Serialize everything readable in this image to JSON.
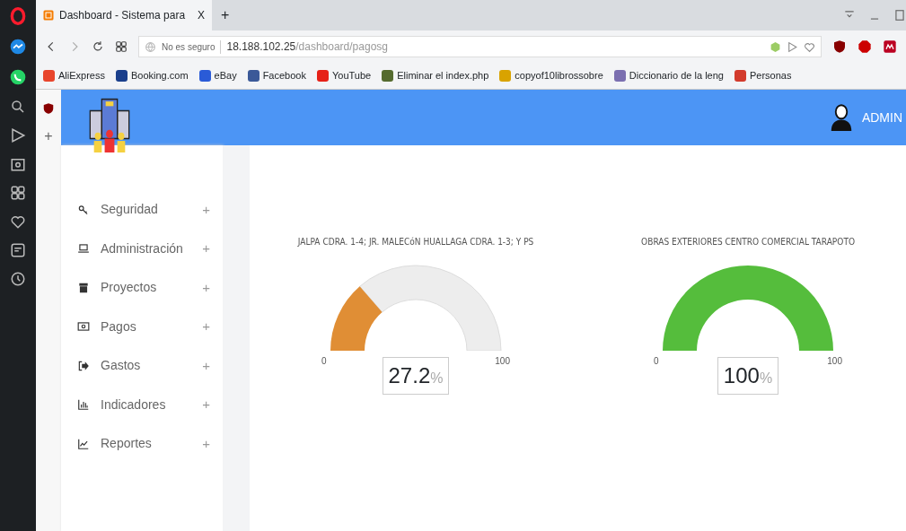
{
  "browser": {
    "tab_title": "Dashboard - Sistema para",
    "tab_close": "X",
    "new_tab": "+",
    "security": "No es seguro",
    "url_host": "18.188.102.25",
    "url_path": "/dashboard/pagosg"
  },
  "bookmarks": [
    {
      "label": "AliExpress",
      "color": "#e8452c"
    },
    {
      "label": "Booking.com",
      "color": "#1a3f8c"
    },
    {
      "label": "eBay",
      "color": "#2a5bd7"
    },
    {
      "label": "Facebook",
      "color": "#3b5998"
    },
    {
      "label": "YouTube",
      "color": "#e62117"
    },
    {
      "label": "Eliminar el index.php",
      "color": "#556b2f"
    },
    {
      "label": "copyof10librossobre",
      "color": "#d9a300"
    },
    {
      "label": "Diccionario de la leng",
      "color": "#7b6fb0"
    },
    {
      "label": "Personas",
      "color": "#d33b2c"
    }
  ],
  "side_panel": {
    "add": "+"
  },
  "header": {
    "user": "ADMIN"
  },
  "menu": [
    {
      "label": "Seguridad",
      "kind": "key",
      "expand": "+"
    },
    {
      "label": "Administración",
      "kind": "laptop",
      "expand": "+"
    },
    {
      "label": "Proyectos",
      "kind": "archive",
      "expand": "+"
    },
    {
      "label": "Pagos",
      "kind": "money",
      "expand": "+"
    },
    {
      "label": "Gastos",
      "kind": "exit",
      "expand": "+"
    },
    {
      "label": "Indicadores",
      "kind": "bars",
      "expand": "+"
    },
    {
      "label": "Reportes",
      "kind": "line",
      "expand": "+"
    }
  ],
  "gauges": [
    {
      "title": "JALPA CDRA. 1-4; JR. MALECóN HUALLAGA CDRA. 1-3; Y PS",
      "level": 0.272,
      "color": "#e08e35",
      "min": "0",
      "max": "100",
      "value": "27.2",
      "unit": "%"
    },
    {
      "title": "OBRAS EXTERIORES CENTRO COMERCIAL TARAPOTO",
      "level": 1,
      "color": "#55bd3c",
      "min": "0",
      "max": "100",
      "value": "100",
      "unit": "%"
    }
  ]
}
